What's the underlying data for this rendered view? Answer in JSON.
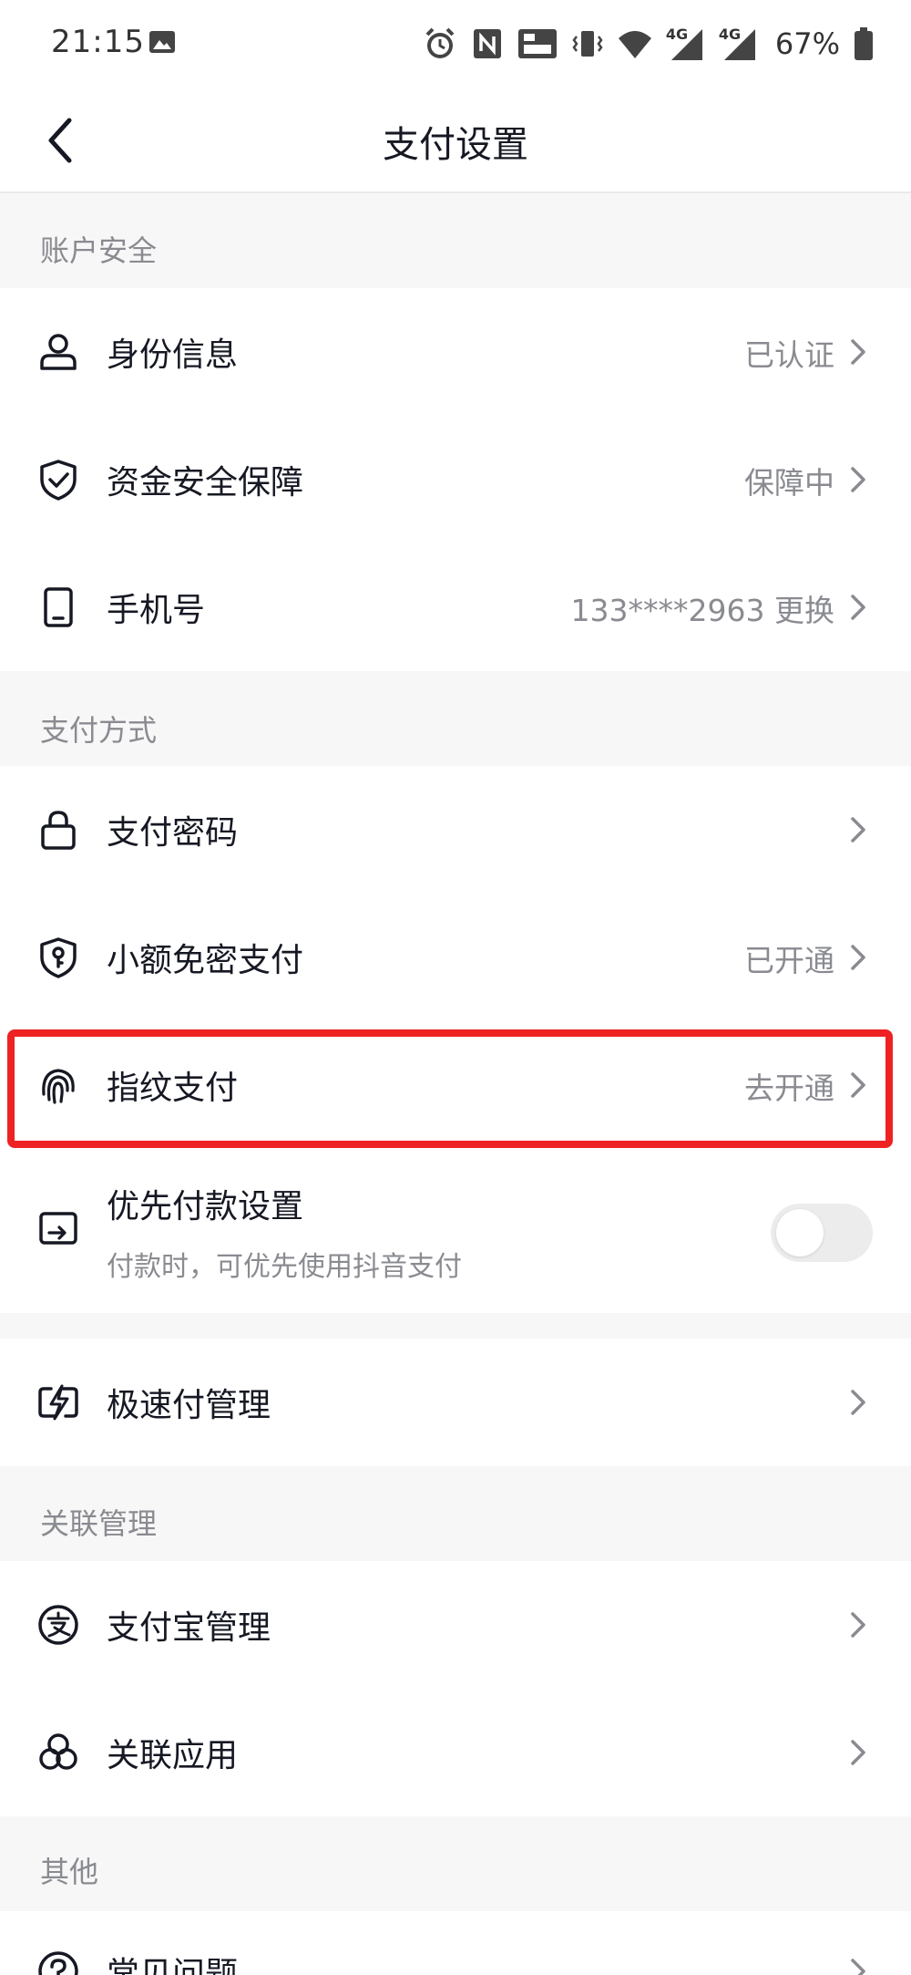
{
  "status_bar": {
    "time": "21:15",
    "network_1": "4G",
    "network_2": "4G",
    "battery": "67%"
  },
  "nav": {
    "title": "支付设置"
  },
  "sections": {
    "account_security": "账户安全",
    "payment_methods": "支付方式",
    "linked_management": "关联管理",
    "other": "其他"
  },
  "rows": {
    "identity": {
      "label": "身份信息",
      "value": "已认证"
    },
    "fund_safety": {
      "label": "资金安全保障",
      "value": "保障中"
    },
    "phone": {
      "label": "手机号",
      "value": "133****2963 更换"
    },
    "pay_password": {
      "label": "支付密码",
      "value": ""
    },
    "small_amount": {
      "label": "小额免密支付",
      "value": "已开通"
    },
    "fingerprint": {
      "label": "指纹支付",
      "value": "去开通"
    },
    "priority": {
      "label": "优先付款设置",
      "sub": "付款时，可优先使用抖音支付",
      "enabled": false
    },
    "express_pay": {
      "label": "极速付管理",
      "value": ""
    },
    "alipay": {
      "label": "支付宝管理",
      "value": ""
    },
    "linked_apps": {
      "label": "关联应用",
      "value": ""
    },
    "faq": {
      "label": "常见问题",
      "value": ""
    }
  },
  "colors": {
    "highlight": "#ee2222",
    "text_primary": "#161823",
    "text_secondary": "#8a8b91",
    "background": "#f7f7f7"
  }
}
